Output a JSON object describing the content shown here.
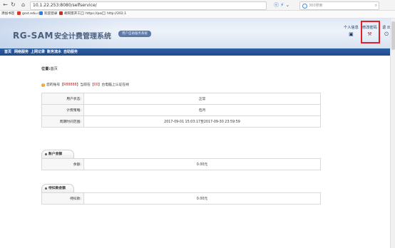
{
  "browser": {
    "url": "10.1.22.253:8080/selfservice/",
    "search_placeholder": "360搜索",
    "bookmarks": [
      "添加书签",
      "gsxt.edu.cn",
      "欢迎登录",
      "胡同客开工业",
      "https://port",
      "http://202.1"
    ]
  },
  "header": {
    "brand": "RG-SAM",
    "system_name": "安全计费管理系统",
    "subtitle": "用户自助服务系统",
    "actions": {
      "profile_label": "个人信息",
      "password_label": "修改密码",
      "logout_label": "退 出"
    }
  },
  "nav": {
    "items": [
      "首页",
      "网络服务",
      "上网记录",
      "账务流水",
      "自助服务"
    ]
  },
  "content": {
    "location_label": "位置:",
    "location_value": "首页",
    "notice": {
      "prefix": "您的账号【",
      "account": "R88888",
      "middle": "】当前在【",
      "count": "00",
      "suffix": "】台电脑上认证在线"
    },
    "account_rows": [
      {
        "label": "用户状态:",
        "value": "正常"
      },
      {
        "label": "计费策略:",
        "value": "包月"
      },
      {
        "label": "周期时间范围:",
        "value": "2017-09-01 15:03:17至2017-09-30 23:59:59"
      }
    ],
    "account_section": {
      "title": "账户金额",
      "rows": [
        {
          "label": "余额:",
          "value": "0.00元"
        }
      ]
    },
    "pending_section": {
      "title": "待扣款金额",
      "rows": [
        {
          "label": "待扣款:",
          "value": "0.00元"
        }
      ]
    }
  },
  "colors": {
    "nav_bg": "#2a5596",
    "highlight_border": "#e0202a",
    "account_red": "#d12020"
  }
}
